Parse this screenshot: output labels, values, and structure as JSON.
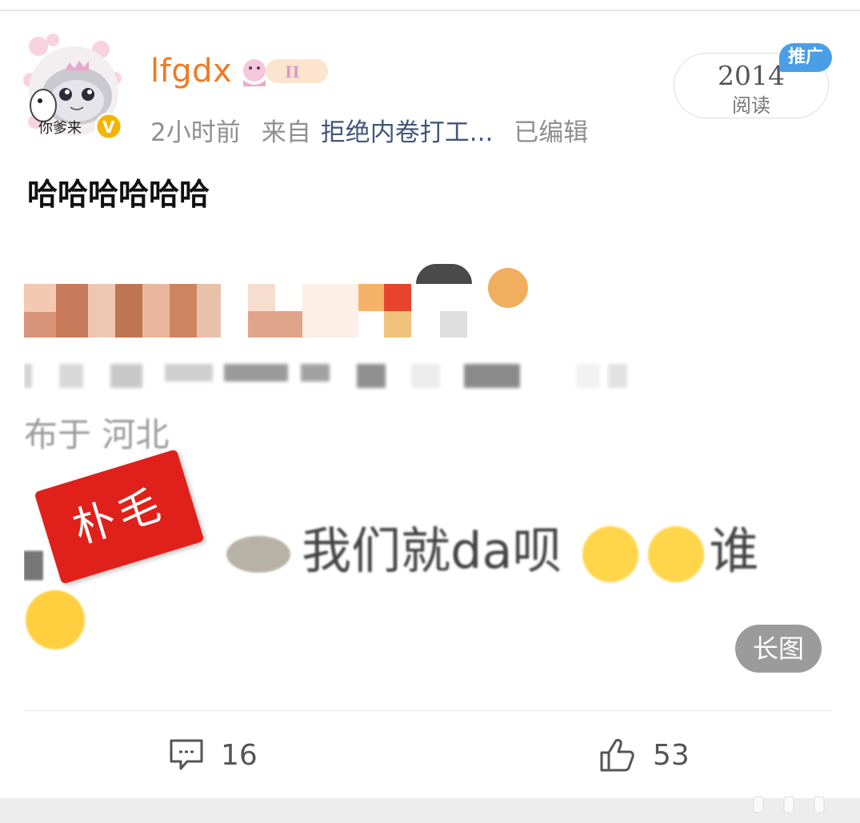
{
  "header": {
    "username": "lfgdx",
    "time": "2小时前",
    "source_prefix": "来自",
    "source": "拒绝内卷打工...",
    "edited": "已编辑",
    "avatar_caption": "你爹来"
  },
  "read_stats": {
    "count": "2014",
    "label": "阅读",
    "promo_badge": "推广"
  },
  "post": {
    "text": "哈哈哈哈哈哈"
  },
  "image": {
    "location_text": "布于 河北",
    "caption": "我们就da呗",
    "caption_tail": "谁",
    "censor_stamp": "朴毛",
    "long_image_badge": "长图"
  },
  "actions": {
    "comment_count": "16",
    "like_count": "53"
  },
  "colors": {
    "username": "#ee7a24",
    "source_link": "#42557a",
    "promo_badge": "#4a9ee6",
    "censor_stamp": "#e0211b"
  },
  "icons": [
    "comment-icon",
    "like-thumb-icon",
    "verified-badge-icon"
  ]
}
